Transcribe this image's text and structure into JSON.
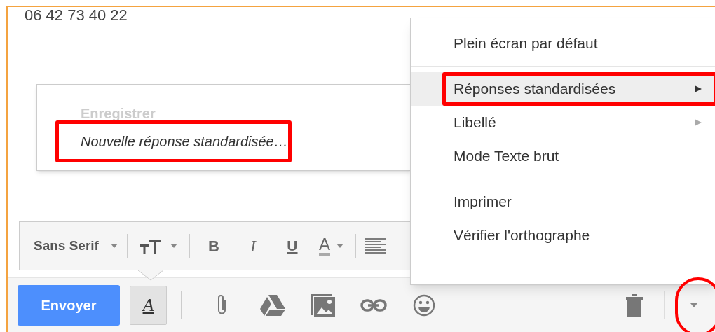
{
  "compose_text": "06 42 73 40 22",
  "canned_menu": {
    "items": [
      {
        "label": "Enregistrer",
        "disabled": true,
        "highlighted": false
      },
      {
        "label": "Nouvelle réponse standardisée…",
        "disabled": false,
        "highlighted": true
      }
    ]
  },
  "format_bar": {
    "font": "Sans Serif",
    "tools": [
      {
        "kind": "size"
      },
      {
        "kind": "bold",
        "label": "B"
      },
      {
        "kind": "italic",
        "label": "I"
      },
      {
        "kind": "underline",
        "label": "U"
      },
      {
        "kind": "color",
        "label": "A"
      },
      {
        "kind": "align"
      }
    ]
  },
  "bottom_bar": {
    "send": "Envoyer",
    "format_toggle": {
      "label": "A",
      "selected": true
    },
    "tools": [
      {
        "kind": "attach"
      },
      {
        "kind": "drive"
      },
      {
        "kind": "photo"
      },
      {
        "kind": "link"
      },
      {
        "kind": "emoji"
      }
    ],
    "more_button": {
      "highlighted": true
    }
  },
  "more_menu": {
    "sections": [
      [
        {
          "label": "Plein écran par défaut",
          "selected": false,
          "has_submenu": false,
          "highlighted": false
        }
      ],
      [
        {
          "label": "Réponses standardisées",
          "selected": true,
          "has_submenu": true,
          "highlighted": true
        },
        {
          "label": "Libellé",
          "selected": false,
          "has_submenu": true,
          "highlighted": false
        },
        {
          "label": "Mode Texte brut",
          "selected": false,
          "has_submenu": false,
          "highlighted": false
        }
      ],
      [
        {
          "label": "Imprimer",
          "selected": false,
          "has_submenu": false,
          "highlighted": false
        },
        {
          "label": "Vérifier l'orthographe",
          "selected": false,
          "has_submenu": false,
          "highlighted": false
        }
      ]
    ]
  }
}
